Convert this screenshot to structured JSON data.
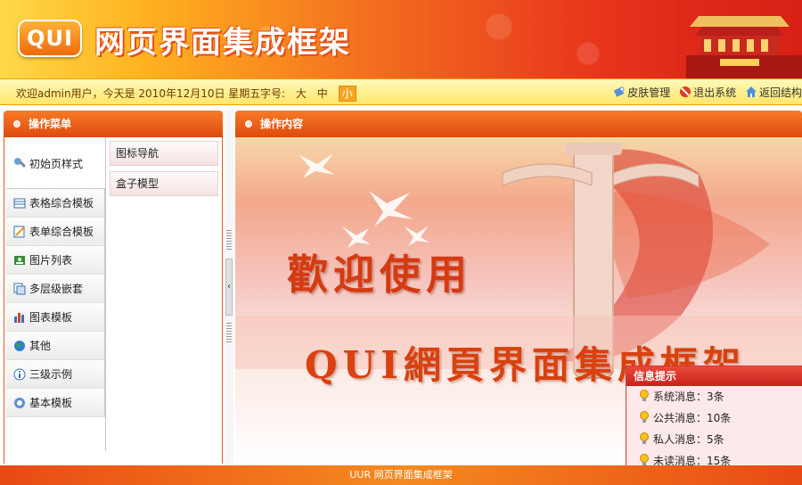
{
  "header": {
    "logo_text": "QUI",
    "app_title": "网页界面集成框架"
  },
  "infobar": {
    "greeting": "欢迎admin用户，今天是 2010年12月10日 星期五",
    "font_size_label": "字号:",
    "font_sizes": [
      "大",
      "中",
      "小"
    ],
    "links": [
      {
        "label": "皮肤管理",
        "icon": "skin-icon"
      },
      {
        "label": "退出系统",
        "icon": "logout-icon"
      },
      {
        "label": "返回结构",
        "icon": "home-icon"
      }
    ]
  },
  "left_panel": {
    "title": "操作菜单",
    "menu": [
      {
        "label": "初始页样式",
        "icon": "gear-icon"
      },
      {
        "label": "表格综合模板",
        "icon": "table-icon"
      },
      {
        "label": "表单综合模板",
        "icon": "form-icon"
      },
      {
        "label": "图片列表",
        "icon": "picture-icon"
      },
      {
        "label": "多层级嵌套",
        "icon": "layers-icon"
      },
      {
        "label": "图表模板",
        "icon": "chart-icon"
      },
      {
        "label": "其他",
        "icon": "globe-icon"
      },
      {
        "label": "三级示例",
        "icon": "info-icon"
      },
      {
        "label": "基本模板",
        "icon": "help-icon"
      }
    ],
    "submenu": [
      "图标导航",
      "盒子模型"
    ]
  },
  "main_panel": {
    "title": "操作内容",
    "welcome_line1": "歡迎使用",
    "welcome_line2": "QUI網頁界面集成框架"
  },
  "info_box": {
    "title": "信息提示",
    "rows": [
      "系统消息：3条",
      "公共消息：10条",
      "私人消息：5条",
      "未读消息：15条"
    ]
  },
  "footer": {
    "text": "UUR 网页界面集成框架"
  },
  "colors": {
    "accent": "#e8561a",
    "infobar": "#ffe66a",
    "popup_title": "#c8211b"
  }
}
